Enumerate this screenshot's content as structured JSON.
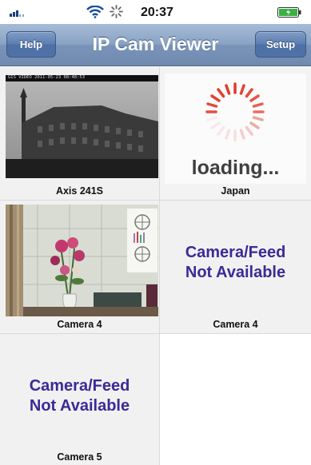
{
  "status_bar": {
    "time": "20:37"
  },
  "nav": {
    "title": "IP Cam Viewer",
    "help_label": "Help",
    "setup_label": "Setup"
  },
  "tiles": [
    {
      "label": "Axis 241S",
      "overlay_text": "GIS VIDEO 2011-05-23 08:48:53"
    },
    {
      "label": "Japan",
      "status": "loading..."
    },
    {
      "label": "Camera 4"
    },
    {
      "label": "Camera 4",
      "status_line1": "Camera/Feed",
      "status_line2": "Not Available"
    },
    {
      "label": "Camera 5",
      "status_line1": "Camera/Feed",
      "status_line2": "Not Available"
    }
  ],
  "colors": {
    "nav_bar": "#7993b9",
    "not_available_text": "#3b2a96",
    "spinner": "#e03a2a",
    "battery": "#3cb043"
  }
}
